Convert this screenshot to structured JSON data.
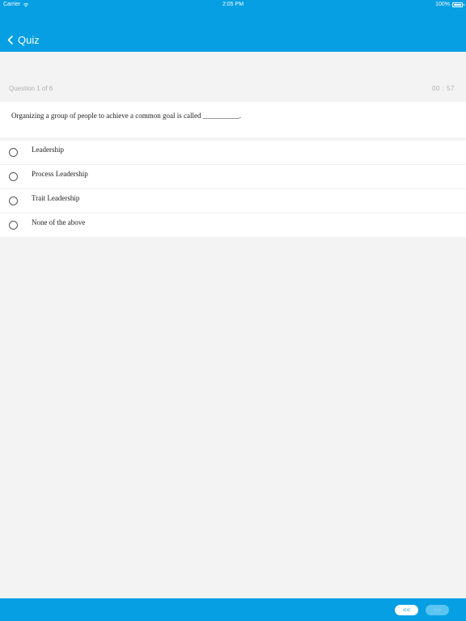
{
  "status_bar": {
    "carrier": "Carrier",
    "time": "2:05 PM",
    "battery": "100%",
    "wifi_icon": "wifi-icon",
    "battery_icon": "battery-full-icon"
  },
  "nav": {
    "back_icon": "chevron-left-icon",
    "title": "Quiz"
  },
  "quiz": {
    "counter": "Question 1 of 6",
    "timer": "00 : 57",
    "question": "Organizing a group of people to achieve a common goal is called __________.",
    "options": [
      {
        "label": "Leadership",
        "selected": false
      },
      {
        "label": "Process Leadership",
        "selected": false
      },
      {
        "label": "Trait Leadership",
        "selected": false
      },
      {
        "label": "None of the above",
        "selected": false
      }
    ]
  },
  "footer": {
    "prev_label": "<<",
    "next_label": ">>",
    "next_enabled": false
  },
  "colors": {
    "accent": "#069fe3",
    "background": "#f3f3f3",
    "card": "#ffffff"
  }
}
